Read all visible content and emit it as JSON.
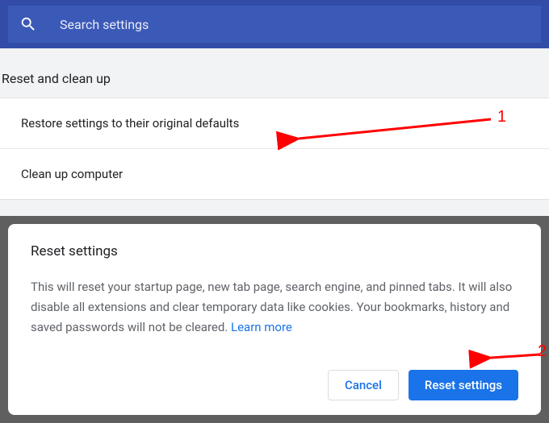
{
  "search": {
    "placeholder": "Search settings"
  },
  "section": {
    "title": "Reset and clean up",
    "items": [
      "Restore settings to their original defaults",
      "Clean up computer"
    ]
  },
  "dialog": {
    "title": "Reset settings",
    "body": "This will reset your startup page, new tab page, search engine, and pinned tabs. It will also disable all extensions and clear temporary data like cookies. Your bookmarks, history and saved passwords will not be cleared. ",
    "learn_more": "Learn more",
    "cancel": "Cancel",
    "confirm": "Reset settings"
  },
  "annotations": {
    "label1": "1",
    "label2": "2"
  }
}
